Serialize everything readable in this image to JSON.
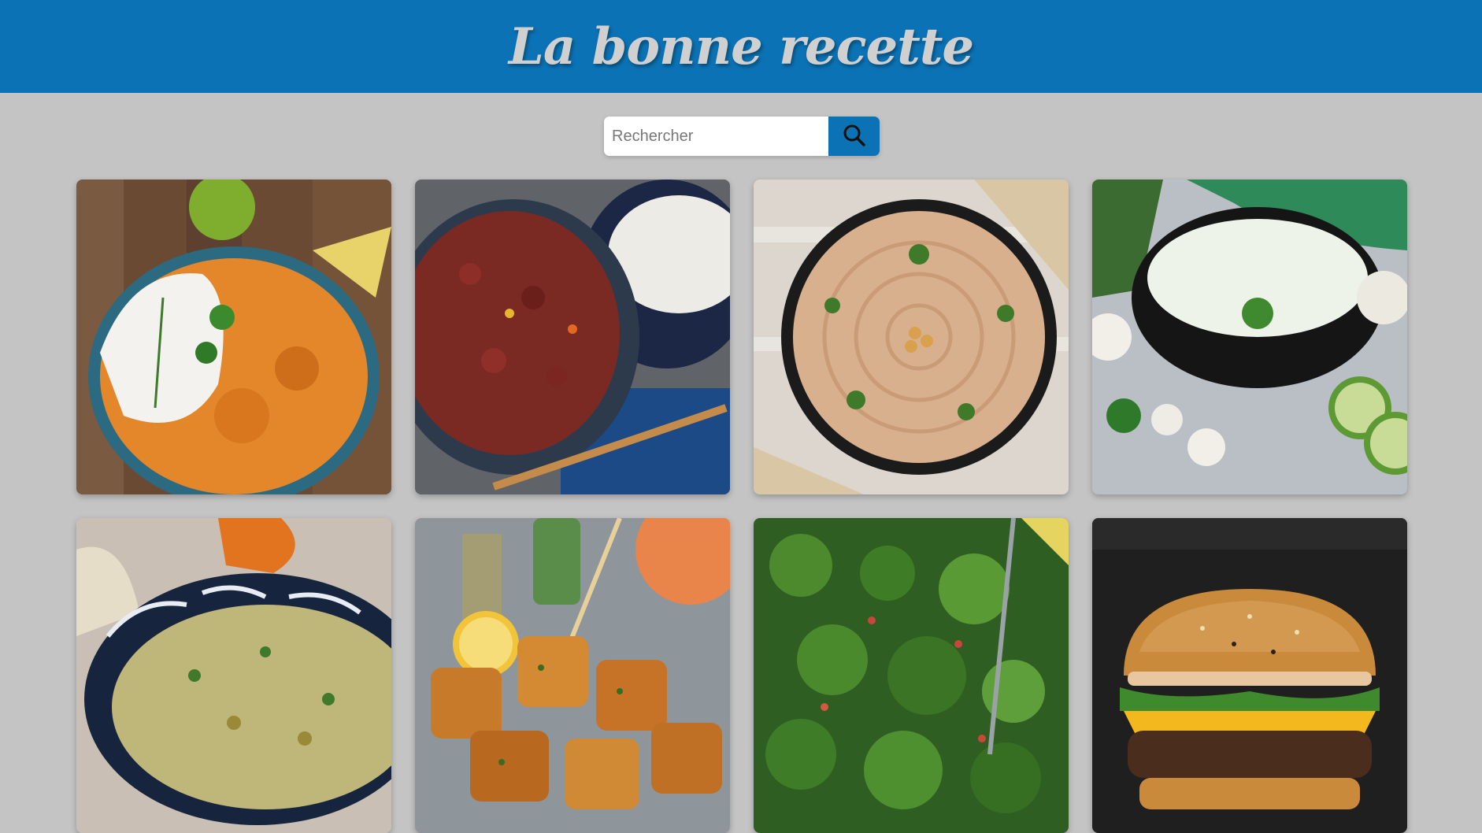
{
  "header": {
    "title": "La bonne recette"
  },
  "search": {
    "placeholder": "Rechercher",
    "value": "",
    "icon": "search-icon"
  },
  "recipes": [
    {
      "image": "chicken-curry-with-rice"
    },
    {
      "image": "kidney-bean-chili-with-rice"
    },
    {
      "image": "hummus"
    },
    {
      "image": "tzatziki"
    },
    {
      "image": "baba-ganoush"
    },
    {
      "image": "roasted-potatoes"
    },
    {
      "image": "tabbouleh"
    },
    {
      "image": "cheeseburger"
    }
  ],
  "colors": {
    "header_bg": "#0b73b5",
    "page_bg": "#c4c4c4",
    "title_color": "#d0d0d0"
  }
}
